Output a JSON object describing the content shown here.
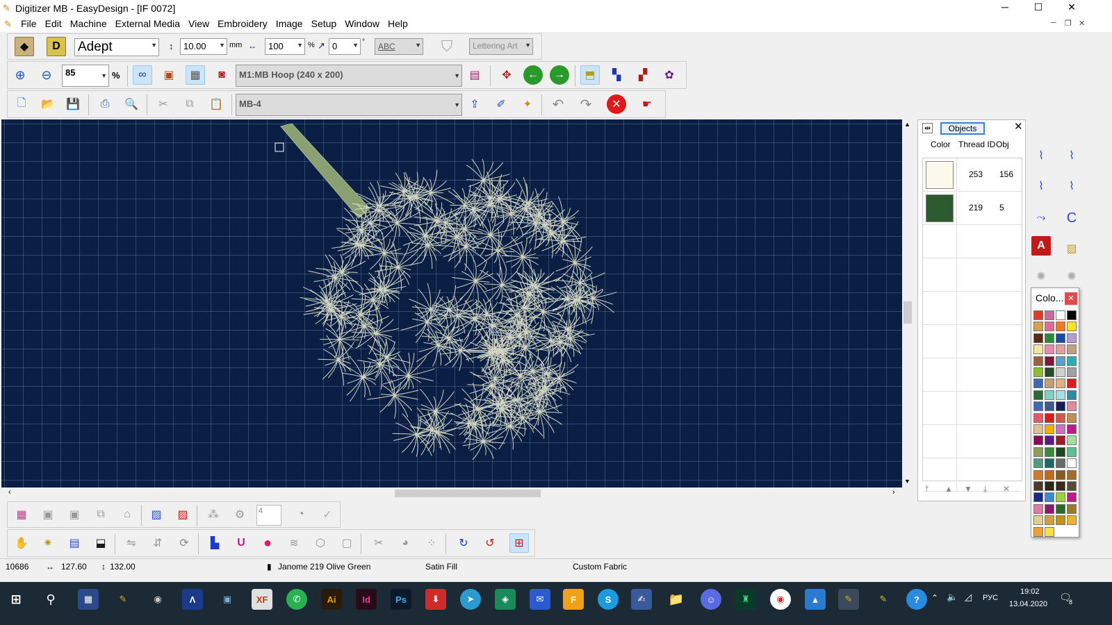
{
  "window": {
    "title": "Digitizer MB - EasyDesign - [IF 0072]",
    "minimize": "─",
    "maximize": "☐",
    "close": "✕"
  },
  "menu": [
    "File",
    "Edit",
    "Machine",
    "External Media",
    "View",
    "Embroidery",
    "Image",
    "Setup",
    "Window",
    "Help"
  ],
  "toolbar1": {
    "font": "Adept",
    "height_value": "10.00",
    "height_unit": "mm",
    "width_value": "100",
    "width_unit": "%",
    "slant_value": "0",
    "slant_unit": "°",
    "abc_label": "ABC",
    "lettering_art": "Lettering Art"
  },
  "toolbar2": {
    "zoom_value": "85",
    "zoom_unit": "%",
    "hoop": "M1:MB Hoop (240 x 200)"
  },
  "toolbar3": {
    "machine": "MB-4"
  },
  "objects_panel": {
    "tab": "Objects",
    "columns": [
      "Color",
      "Thread ID",
      "Obj"
    ],
    "rows": [
      {
        "color": "#fbf8ec",
        "thread_id": "253",
        "obj": "156"
      },
      {
        "color": "#2b5a2f",
        "thread_id": "219",
        "obj": "5"
      }
    ]
  },
  "color_palette": {
    "title": "Colo...",
    "colors": [
      "#e03a2a",
      "#c66aa0",
      "#ffffff",
      "#000000",
      "#d7a24a",
      "#e36a9a",
      "#f07c1c",
      "#ffe51a",
      "#5a2a12",
      "#2a8a3a",
      "#1a4aa8",
      "#b59ad4",
      "#f7e6a0",
      "#e88ab0",
      "#e4a0a0",
      "#c0a080",
      "#a0603a",
      "#7a1a3a",
      "#5aa0c0",
      "#2ab0b0",
      "#8ac030",
      "#2a4a2a",
      "#d0d0d0",
      "#a0a0a0",
      "#3a6ab0",
      "#c0a070",
      "#e0b080",
      "#e01a1a",
      "#2a6a3a",
      "#80d0c0",
      "#a0e0e0",
      "#2a8aa0",
      "#3a6ab0",
      "#3a5a8a",
      "#1a1a5a",
      "#e08aa0",
      "#e05a6a",
      "#e01a1a",
      "#d05a4a",
      "#c0905a",
      "#e0c090",
      "#f0b000",
      "#d070c0",
      "#c01a8a",
      "#8a0a5a",
      "#5a1a8a",
      "#a01a2a",
      "#a0e0a0",
      "#8aa05a",
      "#3a8a3a",
      "#1a4a1a",
      "#5ac090",
      "#4aa080",
      "#1a6a6a",
      "#6a6a6a",
      "#ffffff",
      "#d07a2a",
      "#c06a1a",
      "#8a5a1a",
      "#a0702a",
      "#4a3a2a",
      "#2a2a1a",
      "#3a2a1a",
      "#5a4a3a",
      "#1a2a8a",
      "#3a8ad0",
      "#a0d040",
      "#c01a8a",
      "#e07aa0",
      "#8a1a6a",
      "#2a6a2a",
      "#9a7a2a",
      "#e0d090",
      "#d0a03a",
      "#c0901a",
      "#f0b030",
      "#f0a030",
      "#ffe040"
    ]
  },
  "status": {
    "stitches": "10686",
    "width": "127.60",
    "height": "132.00",
    "thread": "Janome 219 Olive Green",
    "fill": "Satin Fill",
    "fabric": "Custom Fabric"
  },
  "bottom_toolbar": {
    "count_value": "4"
  },
  "taskbar": {
    "lang": "РУС",
    "time": "19:02",
    "date": "13.04.2020",
    "notifications": "8",
    "apps": [
      "XF",
      "Ai",
      "Id",
      "Ps",
      "S"
    ]
  },
  "colors": {
    "canvas": "#0b1f45",
    "stitch": "#e6e8cf",
    "stem": "#8aa072"
  }
}
